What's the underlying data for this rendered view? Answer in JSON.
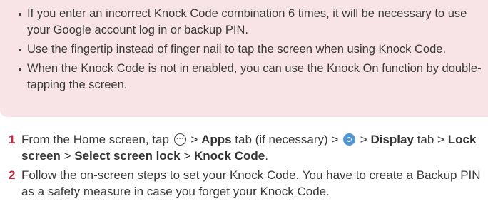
{
  "notes": [
    "If you enter an incorrect Knock Code combination 6 times, it will be necessary to use your Google account log in or backup PIN.",
    "Use the fingertip instead of finger nail to tap the screen when using Knock Code.",
    "When the Knock Code is not in enabled, you can use the Knock On function by double-tapping the screen."
  ],
  "steps": [
    {
      "number": "1",
      "t1": "From the Home screen, tap",
      "t2": ">",
      "apps": "Apps",
      "t3": "tab (if necessary) >",
      "t4": ">",
      "display": "Display",
      "t5": "tab >",
      "lock_screen": "Lock screen",
      "t6": ">",
      "select_screen_lock": "Select screen lock",
      "t7": ">",
      "knock_code": "Knock Code",
      "t8": "."
    },
    {
      "number": "2",
      "text": "Follow the on-screen steps to set your Knock Code. You have to create a Backup PIN as a safety measure in case you forget your Knock Code."
    }
  ],
  "icons": {
    "apps": "apps-icon",
    "settings": "settings-icon"
  },
  "colors": {
    "note_bg": "#f8e4e6",
    "step_number": "#c0293f",
    "settings_icon": "#4f97d6"
  }
}
